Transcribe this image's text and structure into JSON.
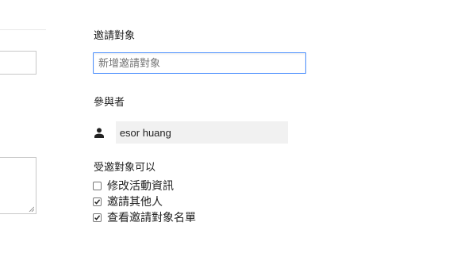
{
  "guests": {
    "heading": "邀請對象",
    "input_value": "",
    "input_placeholder": "新增邀請對象"
  },
  "participants": {
    "heading": "參與者",
    "list": [
      {
        "name": "esor huang",
        "icon": "person-icon"
      }
    ]
  },
  "permissions": {
    "heading": "受邀對象可以",
    "options": [
      {
        "label": "修改活動資訊",
        "checked": false
      },
      {
        "label": "邀請其他人",
        "checked": true
      },
      {
        "label": "查看邀請對象名單",
        "checked": true
      }
    ]
  }
}
